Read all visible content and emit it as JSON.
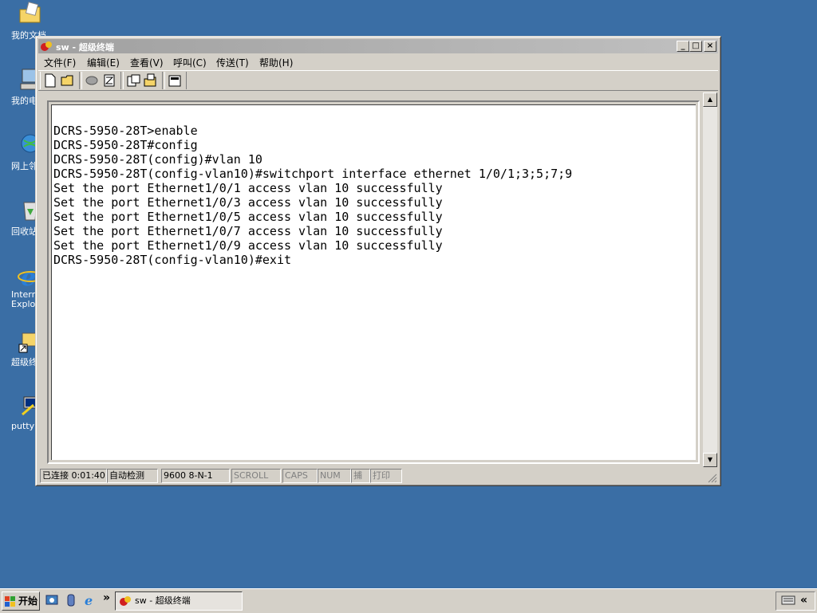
{
  "desktop": {
    "icons": [
      {
        "label": "我的文档",
        "icon": "folder-documents-icon"
      },
      {
        "label": "我的电脑",
        "icon": "computer-icon"
      },
      {
        "label": "网上邻居",
        "icon": "network-icon"
      },
      {
        "label": "回收站",
        "icon": "recycle-bin-icon"
      },
      {
        "label": "Internet Explorer",
        "icon": "ie-icon"
      },
      {
        "label": "超级终端",
        "icon": "hyperterminal-shortcut-icon"
      },
      {
        "label": "putty",
        "icon": "putty-icon"
      }
    ]
  },
  "window": {
    "title": "sw - 超级终端",
    "controls": {
      "minimize": "_",
      "maximize": "□",
      "close": "×"
    },
    "menu": [
      "文件(F)",
      "编辑(E)",
      "查看(V)",
      "呼叫(C)",
      "传送(T)",
      "帮助(H)"
    ],
    "toolbar": [
      "new-icon",
      "open-icon",
      "disconnect-icon",
      "dial-icon",
      "send-icon",
      "receive-icon",
      "properties-icon"
    ],
    "terminal_lines": [
      "DCRS-5950-28T>enable",
      "DCRS-5950-28T#config",
      "DCRS-5950-28T(config)#vlan 10",
      "DCRS-5950-28T(config-vlan10)#switchport interface ethernet 1/0/1;3;5;7;9",
      "Set the port Ethernet1/0/1 access vlan 10 successfully",
      "Set the port Ethernet1/0/3 access vlan 10 successfully",
      "Set the port Ethernet1/0/5 access vlan 10 successfully",
      "Set the port Ethernet1/0/7 access vlan 10 successfully",
      "Set the port Ethernet1/0/9 access vlan 10 successfully",
      "DCRS-5950-28T(config-vlan10)#exit"
    ],
    "status": {
      "connected": "已连接 0:01:40",
      "detect": "自动检测",
      "settings": "9600 8-N-1",
      "scroll": "SCROLL",
      "caps": "CAPS",
      "num": "NUM",
      "capture": "捕",
      "print": "打印"
    }
  },
  "taskbar": {
    "start_label": "开始",
    "task_label": "sw - 超级终端",
    "quicklaunch": [
      "show-desktop-icon",
      "media-icon",
      "ie-quicklaunch-icon"
    ],
    "more": "»",
    "tray_expand": "«"
  }
}
